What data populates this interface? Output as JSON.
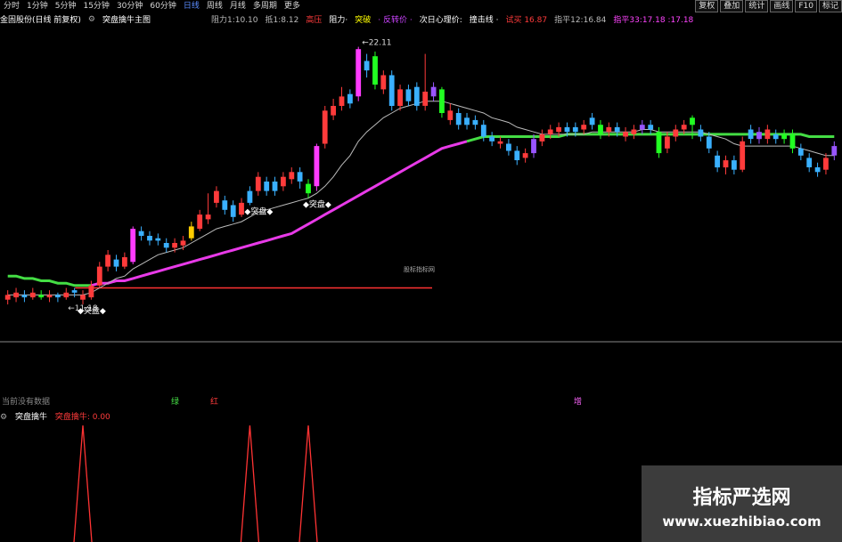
{
  "toolbar": {
    "periods": [
      "分时",
      "1分钟",
      "5分钟",
      "15分钟",
      "30分钟",
      "60分钟",
      "日线",
      "周线",
      "月线",
      "多周期",
      "更多"
    ],
    "active_period": "日线",
    "right_buttons": [
      "复权",
      "叠加",
      "统计",
      "画线",
      "F10",
      "标记"
    ]
  },
  "header": {
    "title": "金固股份(日线 前复权)",
    "indicator": "突盘擒牛主图",
    "items": [
      {
        "text": "阻力1:10.10",
        "color": "#bbbbbb"
      },
      {
        "text": "抵1:8.12",
        "color": "#bbbbbb"
      },
      {
        "text": "高压",
        "color": "#ff3b3b"
      },
      {
        "text": "阻力·",
        "color": "#ffffff"
      },
      {
        "text": "突破",
        "color": "#ffff00"
      },
      {
        "text": "· 反转价 ·",
        "color": "#cc44ff"
      },
      {
        "text": "次日心理价:",
        "color": "#ffffff"
      },
      {
        "text": "撞击线 ·",
        "color": "#ffffff"
      },
      {
        "text": "试买 16.87",
        "color": "#ff3b3b"
      },
      {
        "text": "指平12:16.84",
        "color": "#bbbbbb"
      },
      {
        "text": "指平33:17.18 :17.18",
        "color": "#ff44ff"
      }
    ]
  },
  "annotations": {
    "high_price": "22.11",
    "low_price": "11.18",
    "label_tupan": "突盘",
    "center_mark": "股标指标网"
  },
  "status_row": {
    "left_text": "当前没有数据",
    "mid_green": "绿",
    "mid_red": "红",
    "right_text": "增"
  },
  "subchart": {
    "title": "突盘擒牛",
    "value_label": "突盘擒牛: 0.00"
  },
  "watermark": {
    "title": "指标严选网",
    "url": "www.xuezhibiao.com"
  },
  "colors": {
    "up": "#ff3b3b",
    "down": "#3ab0ff",
    "special_magenta": "#ff3bff",
    "special_green": "#22ff22",
    "special_yellow": "#ffcc00",
    "special_purple": "#9955ff",
    "ma_long": "#e83ae8",
    "ma_long_green": "#44dd44",
    "ma_short": "#bbbbbb",
    "support_line": "#ff3333"
  },
  "chart_data": {
    "type": "candlestick",
    "y_range_visible": [
      11.0,
      22.6
    ],
    "candles": [
      {
        "o": 11.4,
        "c": 11.6,
        "h": 11.8,
        "l": 11.2,
        "k": "up"
      },
      {
        "o": 11.5,
        "c": 11.7,
        "h": 11.9,
        "l": 11.3,
        "k": "up"
      },
      {
        "o": 11.6,
        "c": 11.5,
        "h": 11.8,
        "l": 11.3,
        "k": "down"
      },
      {
        "o": 11.5,
        "c": 11.7,
        "h": 11.9,
        "l": 11.4,
        "k": "up"
      },
      {
        "o": 11.6,
        "c": 11.5,
        "h": 11.8,
        "l": 11.4,
        "k": "green"
      },
      {
        "o": 11.5,
        "c": 11.6,
        "h": 11.8,
        "l": 11.3,
        "k": "up"
      },
      {
        "o": 11.6,
        "c": 11.5,
        "h": 11.7,
        "l": 11.3,
        "k": "down"
      },
      {
        "o": 11.5,
        "c": 11.7,
        "h": 11.9,
        "l": 11.4,
        "k": "up"
      },
      {
        "o": 11.7,
        "c": 11.8,
        "h": 11.9,
        "l": 11.5,
        "k": "down"
      },
      {
        "o": 11.4,
        "c": 11.6,
        "h": 11.8,
        "l": 11.2,
        "k": "up"
      },
      {
        "o": 11.5,
        "c": 12.0,
        "h": 12.2,
        "l": 11.4,
        "k": "up"
      },
      {
        "o": 12.0,
        "c": 12.8,
        "h": 13.0,
        "l": 11.9,
        "k": "up"
      },
      {
        "o": 12.8,
        "c": 13.3,
        "h": 13.5,
        "l": 12.6,
        "k": "up"
      },
      {
        "o": 13.1,
        "c": 12.8,
        "h": 13.3,
        "l": 12.6,
        "k": "down"
      },
      {
        "o": 12.8,
        "c": 13.2,
        "h": 13.4,
        "l": 12.7,
        "k": "up"
      },
      {
        "o": 13.0,
        "c": 14.4,
        "h": 14.5,
        "l": 12.9,
        "k": "magenta"
      },
      {
        "o": 14.3,
        "c": 14.1,
        "h": 14.5,
        "l": 13.9,
        "k": "down"
      },
      {
        "o": 14.1,
        "c": 13.9,
        "h": 14.3,
        "l": 13.7,
        "k": "down"
      },
      {
        "o": 13.9,
        "c": 14.0,
        "h": 14.2,
        "l": 13.7,
        "k": "down"
      },
      {
        "o": 13.8,
        "c": 13.6,
        "h": 14.0,
        "l": 13.4,
        "k": "down"
      },
      {
        "o": 13.6,
        "c": 13.8,
        "h": 14.0,
        "l": 13.4,
        "k": "up"
      },
      {
        "o": 13.7,
        "c": 13.9,
        "h": 14.1,
        "l": 13.5,
        "k": "up"
      },
      {
        "o": 14.0,
        "c": 14.5,
        "h": 14.7,
        "l": 13.9,
        "k": "yellow"
      },
      {
        "o": 14.4,
        "c": 15.0,
        "h": 15.2,
        "l": 14.3,
        "k": "up"
      },
      {
        "o": 15.0,
        "c": 14.8,
        "h": 15.9,
        "l": 14.6,
        "k": "up"
      },
      {
        "o": 15.5,
        "c": 16.0,
        "h": 16.2,
        "l": 15.3,
        "k": "up"
      },
      {
        "o": 15.6,
        "c": 15.2,
        "h": 15.8,
        "l": 15.0,
        "k": "down"
      },
      {
        "o": 15.4,
        "c": 14.9,
        "h": 15.6,
        "l": 14.7,
        "k": "down"
      },
      {
        "o": 15.0,
        "c": 15.5,
        "h": 15.7,
        "l": 14.9,
        "k": "up"
      },
      {
        "o": 15.5,
        "c": 16.0,
        "h": 16.2,
        "l": 15.4,
        "k": "down"
      },
      {
        "o": 16.0,
        "c": 16.6,
        "h": 16.8,
        "l": 15.8,
        "k": "up"
      },
      {
        "o": 16.4,
        "c": 16.0,
        "h": 16.6,
        "l": 15.8,
        "k": "down"
      },
      {
        "o": 16.0,
        "c": 16.4,
        "h": 16.6,
        "l": 15.8,
        "k": "down"
      },
      {
        "o": 16.2,
        "c": 16.6,
        "h": 16.8,
        "l": 16.0,
        "k": "up"
      },
      {
        "o": 16.5,
        "c": 16.8,
        "h": 17.0,
        "l": 16.3,
        "k": "up"
      },
      {
        "o": 16.8,
        "c": 16.4,
        "h": 17.0,
        "l": 16.1,
        "k": "down"
      },
      {
        "o": 15.9,
        "c": 16.3,
        "h": 16.5,
        "l": 15.7,
        "k": "green"
      },
      {
        "o": 16.2,
        "c": 17.9,
        "h": 18.0,
        "l": 16.0,
        "k": "magenta"
      },
      {
        "o": 18.0,
        "c": 19.4,
        "h": 19.6,
        "l": 17.8,
        "k": "up"
      },
      {
        "o": 19.2,
        "c": 19.6,
        "h": 19.9,
        "l": 19.0,
        "k": "up"
      },
      {
        "o": 19.6,
        "c": 20.0,
        "h": 20.4,
        "l": 19.4,
        "k": "up"
      },
      {
        "o": 20.1,
        "c": 19.7,
        "h": 20.3,
        "l": 19.5,
        "k": "down"
      },
      {
        "o": 20.0,
        "c": 22.0,
        "h": 22.1,
        "l": 19.8,
        "k": "magenta"
      },
      {
        "o": 21.5,
        "c": 21.1,
        "h": 21.8,
        "l": 20.8,
        "k": "down"
      },
      {
        "o": 21.7,
        "c": 20.5,
        "h": 21.9,
        "l": 20.3,
        "k": "green"
      },
      {
        "o": 20.3,
        "c": 20.9,
        "h": 21.1,
        "l": 20.1,
        "k": "up"
      },
      {
        "o": 20.9,
        "c": 19.6,
        "h": 21.1,
        "l": 19.4,
        "k": "down"
      },
      {
        "o": 19.6,
        "c": 20.3,
        "h": 20.5,
        "l": 19.4,
        "k": "up"
      },
      {
        "o": 20.3,
        "c": 19.8,
        "h": 20.5,
        "l": 19.6,
        "k": "down"
      },
      {
        "o": 20.4,
        "c": 19.6,
        "h": 20.6,
        "l": 19.4,
        "k": "down"
      },
      {
        "o": 19.6,
        "c": 20.2,
        "h": 21.8,
        "l": 19.4,
        "k": "up"
      },
      {
        "o": 20.0,
        "c": 20.4,
        "h": 20.6,
        "l": 19.8,
        "k": "purple"
      },
      {
        "o": 20.3,
        "c": 19.3,
        "h": 20.4,
        "l": 19.1,
        "k": "green"
      },
      {
        "o": 19.0,
        "c": 19.4,
        "h": 19.7,
        "l": 18.8,
        "k": "up"
      },
      {
        "o": 19.3,
        "c": 18.8,
        "h": 19.5,
        "l": 18.6,
        "k": "down"
      },
      {
        "o": 18.8,
        "c": 19.1,
        "h": 19.3,
        "l": 18.6,
        "k": "down"
      },
      {
        "o": 19.0,
        "c": 18.8,
        "h": 19.2,
        "l": 18.6,
        "k": "down"
      },
      {
        "o": 18.8,
        "c": 18.3,
        "h": 19.0,
        "l": 18.1,
        "k": "down"
      },
      {
        "o": 18.3,
        "c": 18.1,
        "h": 18.5,
        "l": 17.9,
        "k": "down"
      },
      {
        "o": 18.1,
        "c": 18.0,
        "h": 18.3,
        "l": 17.8,
        "k": "up"
      },
      {
        "o": 18.0,
        "c": 17.7,
        "h": 18.2,
        "l": 17.5,
        "k": "down"
      },
      {
        "o": 17.7,
        "c": 17.3,
        "h": 17.9,
        "l": 17.1,
        "k": "down"
      },
      {
        "o": 17.4,
        "c": 17.6,
        "h": 17.8,
        "l": 17.2,
        "k": "up"
      },
      {
        "o": 17.6,
        "c": 18.2,
        "h": 18.4,
        "l": 17.4,
        "k": "purple"
      },
      {
        "o": 18.1,
        "c": 18.4,
        "h": 18.6,
        "l": 17.9,
        "k": "up"
      },
      {
        "o": 18.4,
        "c": 18.6,
        "h": 18.8,
        "l": 18.2,
        "k": "up"
      },
      {
        "o": 18.5,
        "c": 18.7,
        "h": 18.9,
        "l": 18.3,
        "k": "up"
      },
      {
        "o": 18.7,
        "c": 18.5,
        "h": 18.9,
        "l": 18.3,
        "k": "down"
      },
      {
        "o": 18.5,
        "c": 18.7,
        "h": 18.9,
        "l": 18.3,
        "k": "down"
      },
      {
        "o": 18.6,
        "c": 18.8,
        "h": 19.0,
        "l": 18.4,
        "k": "up"
      },
      {
        "o": 18.8,
        "c": 19.1,
        "h": 19.3,
        "l": 18.6,
        "k": "down"
      },
      {
        "o": 18.8,
        "c": 18.4,
        "h": 19.0,
        "l": 18.2,
        "k": "green"
      },
      {
        "o": 18.5,
        "c": 18.7,
        "h": 18.9,
        "l": 18.3,
        "k": "up"
      },
      {
        "o": 18.7,
        "c": 18.5,
        "h": 18.9,
        "l": 18.3,
        "k": "down"
      },
      {
        "o": 18.5,
        "c": 18.3,
        "h": 18.7,
        "l": 18.1,
        "k": "up"
      },
      {
        "o": 18.4,
        "c": 18.6,
        "h": 18.8,
        "l": 18.2,
        "k": "up"
      },
      {
        "o": 18.6,
        "c": 18.8,
        "h": 19.0,
        "l": 18.4,
        "k": "purple"
      },
      {
        "o": 18.8,
        "c": 18.6,
        "h": 19.0,
        "l": 18.4,
        "k": "down"
      },
      {
        "o": 18.5,
        "c": 17.6,
        "h": 18.7,
        "l": 17.4,
        "k": "green"
      },
      {
        "o": 17.8,
        "c": 18.3,
        "h": 18.5,
        "l": 17.6,
        "k": "up"
      },
      {
        "o": 18.3,
        "c": 18.6,
        "h": 18.8,
        "l": 18.1,
        "k": "up"
      },
      {
        "o": 18.6,
        "c": 18.8,
        "h": 19.0,
        "l": 18.4,
        "k": "up"
      },
      {
        "o": 18.8,
        "c": 19.1,
        "h": 19.2,
        "l": 18.2,
        "k": "green"
      },
      {
        "o": 18.6,
        "c": 18.3,
        "h": 18.8,
        "l": 18.1,
        "k": "down"
      },
      {
        "o": 18.3,
        "c": 17.8,
        "h": 18.5,
        "l": 17.6,
        "k": "down"
      },
      {
        "o": 17.5,
        "c": 17.0,
        "h": 17.7,
        "l": 16.8,
        "k": "down"
      },
      {
        "o": 17.0,
        "c": 17.3,
        "h": 17.5,
        "l": 16.7,
        "k": "up"
      },
      {
        "o": 17.3,
        "c": 16.9,
        "h": 17.5,
        "l": 16.7,
        "k": "down"
      },
      {
        "o": 16.9,
        "c": 18.1,
        "h": 18.3,
        "l": 16.8,
        "k": "up"
      },
      {
        "o": 18.2,
        "c": 18.6,
        "h": 18.8,
        "l": 18.0,
        "k": "down"
      },
      {
        "o": 18.5,
        "c": 18.2,
        "h": 18.7,
        "l": 18.0,
        "k": "purple"
      },
      {
        "o": 18.2,
        "c": 18.6,
        "h": 18.8,
        "l": 18.0,
        "k": "up"
      },
      {
        "o": 18.4,
        "c": 18.2,
        "h": 18.6,
        "l": 18.0,
        "k": "down"
      },
      {
        "o": 18.2,
        "c": 18.4,
        "h": 18.6,
        "l": 18.0,
        "k": "green"
      },
      {
        "o": 18.4,
        "c": 17.8,
        "h": 18.6,
        "l": 17.6,
        "k": "green"
      },
      {
        "o": 17.8,
        "c": 17.5,
        "h": 18.0,
        "l": 17.3,
        "k": "down"
      },
      {
        "o": 17.4,
        "c": 17.0,
        "h": 17.6,
        "l": 16.8,
        "k": "down"
      },
      {
        "o": 17.0,
        "c": 16.8,
        "h": 17.2,
        "l": 16.6,
        "k": "down"
      },
      {
        "o": 16.9,
        "c": 17.4,
        "h": 17.6,
        "l": 16.7,
        "k": "up"
      },
      {
        "o": 17.5,
        "c": 17.9,
        "h": 18.1,
        "l": 17.3,
        "k": "purple"
      }
    ],
    "ma_short": [
      11.6,
      11.6,
      11.6,
      11.6,
      11.6,
      11.6,
      11.6,
      11.6,
      11.6,
      11.6,
      11.7,
      11.9,
      12.1,
      12.3,
      12.4,
      12.7,
      12.9,
      13.1,
      13.3,
      13.4,
      13.5,
      13.6,
      13.8,
      14.0,
      14.2,
      14.4,
      14.5,
      14.6,
      14.7,
      14.9,
      15.1,
      15.2,
      15.3,
      15.4,
      15.5,
      15.6,
      15.7,
      15.9,
      16.2,
      16.6,
      17.1,
      17.5,
      18.1,
      18.5,
      18.8,
      19.1,
      19.3,
      19.5,
      19.6,
      19.7,
      19.8,
      19.8,
      19.8,
      19.7,
      19.6,
      19.5,
      19.4,
      19.3,
      19.1,
      19.0,
      18.9,
      18.7,
      18.6,
      18.5,
      18.4,
      18.4,
      18.4,
      18.4,
      18.4,
      18.4,
      18.5,
      18.5,
      18.5,
      18.5,
      18.5,
      18.5,
      18.6,
      18.6,
      18.5,
      18.5,
      18.5,
      18.5,
      18.5,
      18.5,
      18.4,
      18.3,
      18.2,
      18.0,
      17.9,
      17.9,
      17.9,
      17.9,
      17.9,
      17.9,
      17.9,
      17.8,
      17.7,
      17.6,
      17.5,
      17.5
    ],
    "ma_long": [
      12.4,
      12.4,
      12.3,
      12.3,
      12.2,
      12.2,
      12.1,
      12.1,
      12.0,
      12.0,
      12.0,
      12.1,
      12.1,
      12.2,
      12.2,
      12.3,
      12.4,
      12.5,
      12.6,
      12.7,
      12.8,
      12.9,
      13.0,
      13.1,
      13.2,
      13.3,
      13.4,
      13.5,
      13.6,
      13.7,
      13.8,
      13.9,
      14.0,
      14.1,
      14.2,
      14.4,
      14.6,
      14.8,
      15.0,
      15.2,
      15.4,
      15.6,
      15.8,
      16.0,
      16.2,
      16.4,
      16.6,
      16.8,
      17.0,
      17.2,
      17.4,
      17.6,
      17.8,
      17.9,
      18.0,
      18.1,
      18.2,
      18.3,
      18.3,
      18.3,
      18.3,
      18.3,
      18.3,
      18.3,
      18.3,
      18.3,
      18.3,
      18.4,
      18.4,
      18.4,
      18.4,
      18.4,
      18.4,
      18.4,
      18.4,
      18.4,
      18.4,
      18.4,
      18.4,
      18.4,
      18.4,
      18.4,
      18.4,
      18.4,
      18.4,
      18.4,
      18.4,
      18.4,
      18.4,
      18.4,
      18.4,
      18.4,
      18.4,
      18.4,
      18.4,
      18.4,
      18.3,
      18.3,
      18.3,
      18.3
    ],
    "ma_long_turn_green_at": 55,
    "support_price": 11.9,
    "high_index": 42,
    "low_index": 7,
    "tupan_marks": [
      9,
      29,
      36
    ],
    "sub_spikes": [
      9,
      29,
      36
    ],
    "sub_y_range": [
      0,
      1
    ]
  }
}
